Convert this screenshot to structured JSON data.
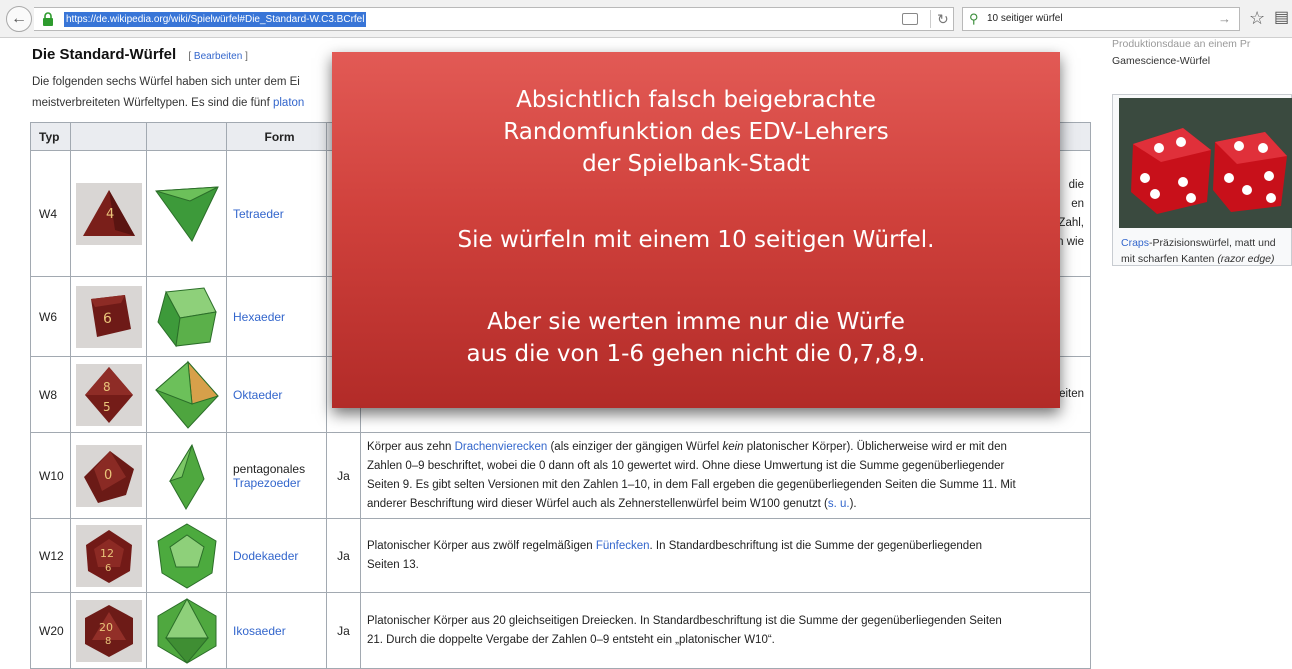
{
  "browser": {
    "url": "https://de.wikipedia.org/wiki/Spielwürfel#Die_Standard-W.C3.BCrfel",
    "search_value": "10 seitiger würfel"
  },
  "article": {
    "heading": "Die Standard-Würfel",
    "edit_link_open": "[",
    "edit_link": "Bearbeiten",
    "edit_link_close": "]",
    "intro_line1": "Die folgenden sechs Würfel haben sich unter dem Ei",
    "intro_line2_prefix": "meistverbreiteten Würfeltypen. Es sind die fünf",
    "intro_line2_link": "platon"
  },
  "table": {
    "headers": {
      "typ": "Typ",
      "form": "Form"
    },
    "rows": [
      {
        "typ": "W4",
        "form": "Tetraeder",
        "platonic": "",
        "desc_parts": [
          "die",
          "en",
          "Zahl,",
          "en wie"
        ],
        "die_color": "#7a1f1a",
        "solid_color": "#3d9a3a"
      },
      {
        "typ": "W6",
        "form": "Hexaeder",
        "platonic": "",
        "desc_parts": [],
        "die_color": "#6e1a17",
        "solid_color": "#5bb04a"
      },
      {
        "typ": "W8",
        "form": "Oktaeder",
        "platonic": "",
        "desc_parts": [
          "eiten"
        ],
        "die_color": "#741c18",
        "solid_color": "#4ea53f"
      },
      {
        "typ": "W10",
        "form_line1": "pentagonales",
        "form_link": "Trapezoeder",
        "platonic": "Ja",
        "desc1": "Körper aus zehn ",
        "desc1_link": "Drachenvierecken",
        "desc1b": " (als einziger der gängigen Würfel ",
        "desc1_em": "kein",
        "desc1c": " platonischer Körper). Üblicherweise wird er mit den",
        "desc2": "Zahlen 0–9 beschriftet, wobei die 0 dann oft als 10 gewertet wird. Ohne diese Umwertung ist die Summe gegenüberliegender",
        "desc3": "Seiten 9. Es gibt selten Versionen mit den Zahlen 1–10, in dem Fall ergeben die gegenüberliegenden Seiten die Summe 11. Mit",
        "desc4": "anderer Beschriftung wird dieser Würfel auch als Zehnerstellenwürfel beim W100 genutzt (",
        "desc4_link": "s. u.",
        "desc4_end": ").",
        "die_color": "#6b1a16",
        "solid_color": "#4fa83f"
      },
      {
        "typ": "W12",
        "form": "Dodekaeder",
        "platonic": "Ja",
        "desc1": "Platonischer Körper aus zwölf regelmäßigen ",
        "desc1_link": "Fünfecken",
        "desc1b": ". In Standardbeschriftung ist die Summe der gegenüberliegenden",
        "desc2": "Seiten 13.",
        "die_color": "#721a17",
        "solid_color": "#4caa3e"
      },
      {
        "typ": "W20",
        "form": "Ikosaeder",
        "platonic": "Ja",
        "desc1": "Platonischer Körper aus 20 gleichseitigen Dreiecken. In Standardbeschriftung ist die Summe der gegenüberliegenden Seiten",
        "desc2": "21. Durch die doppelte Vergabe der Zahlen 0–9 entsteht ein „platonischer W10“.",
        "die_color": "#6d1b17",
        "solid_color": "#4fa83f"
      }
    ]
  },
  "overlay": {
    "line1": "Absichtlich falsch beigebrachte",
    "line2": "Randomfunktion des EDV-Lehrers",
    "line3": "der  Spielbank-Stadt",
    "line4": "Sie würfeln mit einem 10 seitigen Würfel.",
    "line5": "Aber sie werten imme nur die Würfe",
    "line6": "aus die von 1-6 gehen nicht die 0,7,8,9.",
    "color": "#d0413c"
  },
  "sidebar": {
    "top_caption_line1": "Produktionsdaue an einem   Pr",
    "top_caption_line2": "Gamescience-Würfel",
    "caption_link": "Craps",
    "caption_line1_rest": "-Präzisionswürfel, matt und",
    "caption_line2": "mit scharfen Kanten ",
    "caption_em": "(razor edge)"
  }
}
